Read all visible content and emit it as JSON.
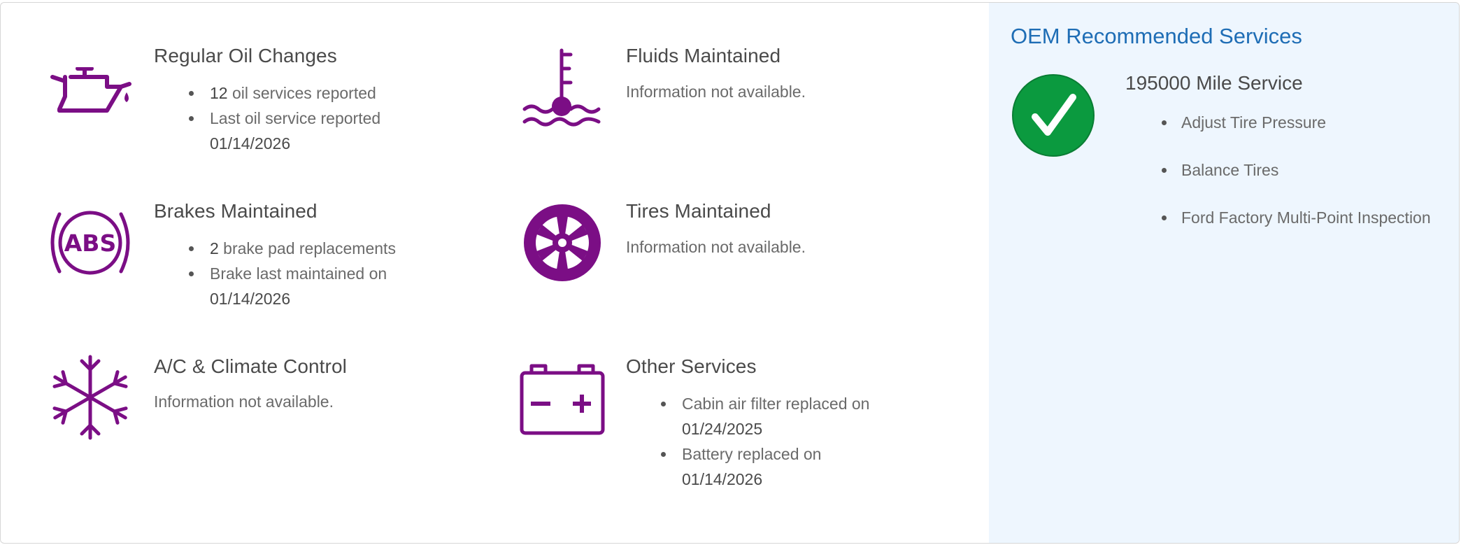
{
  "colors": {
    "icon_purple": "#7b0e85",
    "oem_blue": "#1e6db5",
    "check_green": "#0b9a3f",
    "panel_bg": "#eef6fe"
  },
  "oil": {
    "icon": "oil-can-icon",
    "title": "Regular Oil Changes",
    "count": "12",
    "count_suffix": " oil services reported",
    "last_label": "Last oil service reported",
    "last_date": "01/14/2026"
  },
  "fluids": {
    "icon": "fluid-temperature-icon",
    "title": "Fluids Maintained",
    "status": "Information not available."
  },
  "brakes": {
    "icon": "abs-icon",
    "title": "Brakes Maintained",
    "count": "2",
    "count_suffix": " brake pad replacements",
    "last_label": "Brake last maintained on",
    "last_date": "01/14/2026"
  },
  "tires": {
    "icon": "tire-icon",
    "title": "Tires Maintained",
    "status": "Information not available."
  },
  "ac": {
    "icon": "snowflake-icon",
    "title": "A/C & Climate Control",
    "status": "Information not available."
  },
  "other": {
    "icon": "battery-icon",
    "title": "Other Services",
    "items": [
      {
        "label": "Cabin air filter replaced on",
        "date": "01/24/2025"
      },
      {
        "label": "Battery replaced on",
        "date": "01/14/2026"
      }
    ]
  },
  "oem": {
    "title": "OEM Recommended Services",
    "icon": "checkmark-icon",
    "service_title": "195000 Mile Service",
    "services": [
      "Adjust Tire Pressure",
      "Balance Tires",
      "Ford Factory Multi-Point Inspection"
    ]
  }
}
